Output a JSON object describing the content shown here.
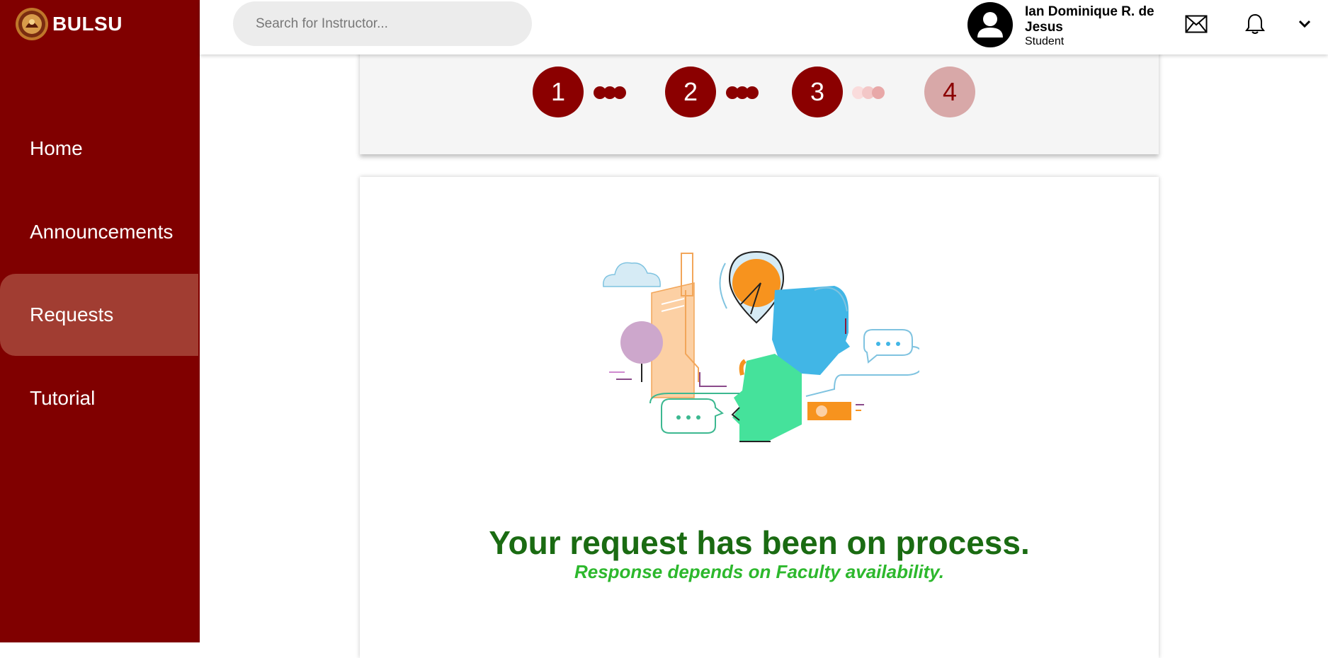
{
  "brand": {
    "name": "BULSU"
  },
  "sidebar": {
    "items": [
      {
        "label": "Home"
      },
      {
        "label": "Announcements"
      },
      {
        "label": "Requests"
      },
      {
        "label": "Tutorial"
      }
    ],
    "active_index": 2
  },
  "header": {
    "search": {
      "placeholder": "Search for Instructor...",
      "value": ""
    },
    "user": {
      "name": "Ian Dominique R. de Jesus",
      "role": "Student"
    },
    "icons": [
      "mail-icon",
      "bell-icon",
      "chevron-down-icon"
    ]
  },
  "stepper": {
    "steps": [
      {
        "label": "1",
        "state": "done"
      },
      {
        "label": "2",
        "state": "done"
      },
      {
        "label": "3",
        "state": "done"
      },
      {
        "label": "4",
        "state": "pending"
      }
    ]
  },
  "message": {
    "title": "Your request has been on process.",
    "subtitle": "Response depends on Faculty availability."
  },
  "colors": {
    "sidebar": "#800000",
    "active_nav": "#a13d32",
    "step_done": "#8b0000",
    "step_pending": "#d8a8a8",
    "title_green": "#1a6b12",
    "subtitle_green": "#2db82d"
  }
}
